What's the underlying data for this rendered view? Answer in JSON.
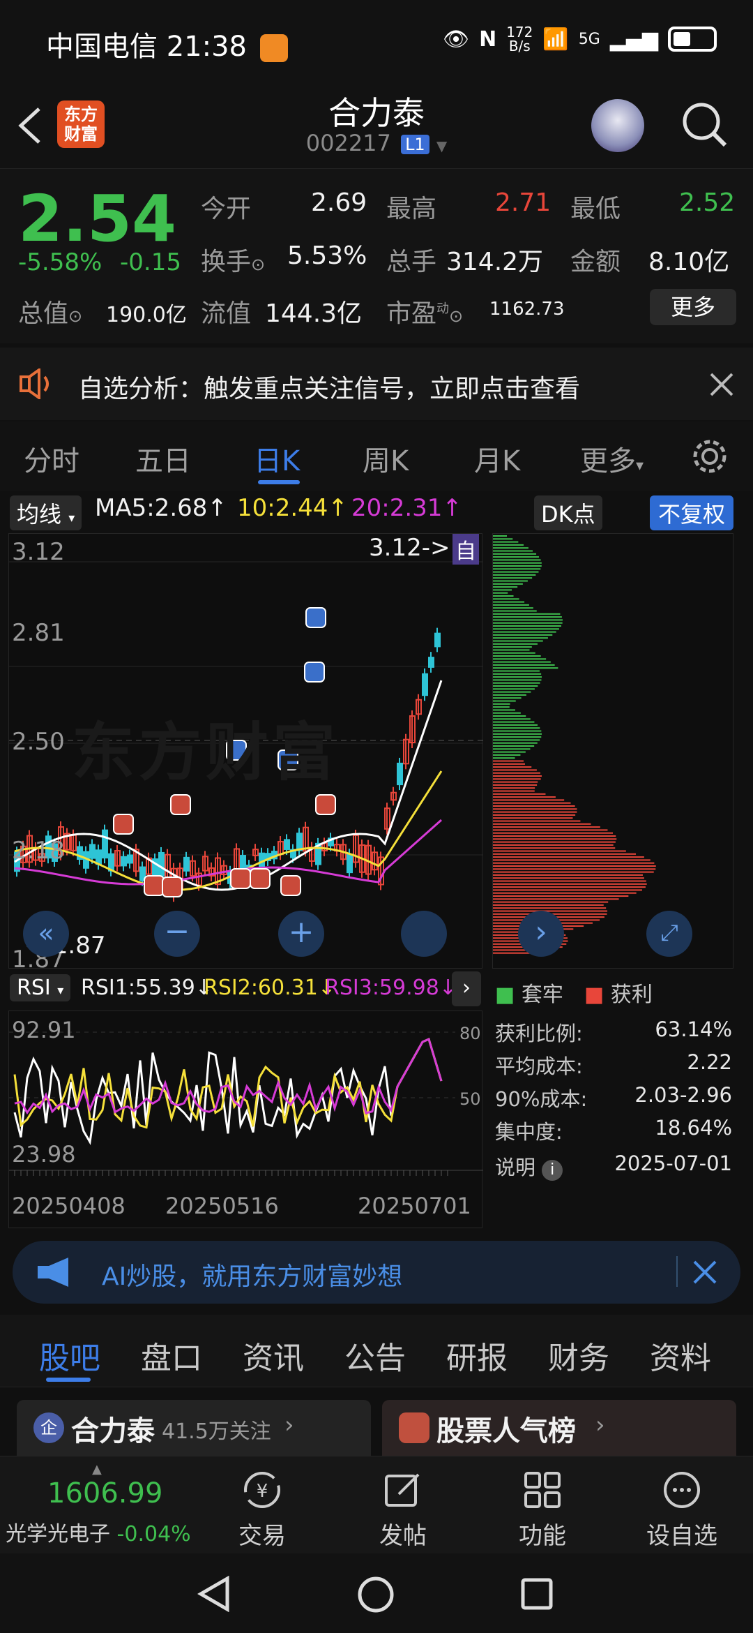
{
  "status_bar": {
    "carrier": "中国电信",
    "time": "21:38",
    "net_speed_top": "172",
    "net_speed_unit": "B/s",
    "signal_label": "5G",
    "battery_level": 0.45
  },
  "header": {
    "logo_text": "东方\n财富",
    "title": "合力泰",
    "code": "002217",
    "level_badge": "L1"
  },
  "quote": {
    "price": "2.54",
    "change_pct": "-5.58%",
    "change_abs": "-0.15",
    "open_label": "今开",
    "open_value": "2.69",
    "high_label": "最高",
    "high_value": "2.71",
    "low_label": "最低",
    "low_value": "2.52",
    "turnover_label": "换手",
    "turnover_value": "5.53%",
    "volume_label": "总手",
    "volume_value": "314.2万",
    "amount_label": "金额",
    "amount_value": "8.10亿",
    "mcap_label": "总值",
    "mcap_value": "190.0亿",
    "float_label": "流值",
    "float_value": "144.3亿",
    "pe_label": "市盈",
    "pe_sup": "动",
    "pe_value": "1162.73",
    "more_button": "更多"
  },
  "notice": {
    "text": "自选分析：触发重点关注信号，立即点击查看"
  },
  "period_tabs": [
    "分时",
    "五日",
    "日K",
    "周K",
    "月K",
    "更多"
  ],
  "period_active": "日K",
  "chart_toolbar": {
    "indicator": "均线",
    "ma5": "MA5:2.68↑",
    "ma10": "10:2.44↑",
    "ma20": "20:2.31↑",
    "dk_button": "DK点",
    "adjust_button": "不复权"
  },
  "kline": {
    "y_labels": [
      "3.12",
      "2.81",
      "2.50",
      "2.18",
      "1.87"
    ],
    "max_marker": "3.12->",
    "min_marker": "<-1.87",
    "self_marker": "自",
    "signal_b": "B",
    "signal_s": "S",
    "watermark": "东方财富"
  },
  "rsi": {
    "indicator": "RSI",
    "rsi1": "RSI1:55.39↓",
    "rsi2": "RSI2:60.31↓",
    "rsi3": "RSI3:59.98↓",
    "y_top": "92.91",
    "y_bottom": "23.98",
    "level_80": "80",
    "level_50": "50",
    "dates": [
      "20250408",
      "20250516",
      "20250701"
    ]
  },
  "cost_panel": {
    "legend_trapped": "套牢",
    "legend_profit": "获利",
    "rows": [
      {
        "label": "获利比例:",
        "value": "63.14%"
      },
      {
        "label": "平均成本:",
        "value": "2.22"
      },
      {
        "label": "90%成本:",
        "value": "2.03-2.96"
      },
      {
        "label": "集中度:",
        "value": "18.64%"
      }
    ],
    "note_label": "说明",
    "date": "2025-07-01"
  },
  "ai_banner": {
    "text": "AI炒股，就用东方财富妙想"
  },
  "content_tabs": [
    "股吧",
    "盘口",
    "资讯",
    "公告",
    "研报",
    "财务",
    "资料"
  ],
  "content_active": "股吧",
  "cards": {
    "left_badge": "企",
    "left_title": "合力泰",
    "left_follow": "41.5万关注",
    "right_title": "股票人气榜"
  },
  "bottom_nav": {
    "index_value": "1606.99",
    "index_name": "光学光电子",
    "index_change": "-0.04%",
    "items": [
      "交易",
      "发帖",
      "功能",
      "设自选"
    ]
  },
  "colors": {
    "up": "#e8463a",
    "down": "#3fbf4f",
    "accent": "#3d7de8",
    "ma5": "#ffffff",
    "ma10": "#f5e03a",
    "ma20": "#d63bd6"
  }
}
